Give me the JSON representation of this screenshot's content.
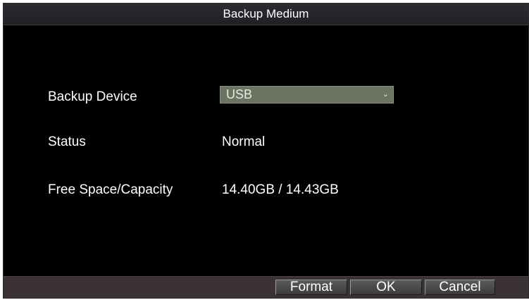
{
  "dialog": {
    "title": "Backup Medium"
  },
  "fields": {
    "backup_device": {
      "label": "Backup Device",
      "value": "USB"
    },
    "status": {
      "label": "Status",
      "value": "Normal"
    },
    "capacity": {
      "label": "Free Space/Capacity",
      "value": "14.40GB / 14.43GB"
    }
  },
  "buttons": {
    "format": "Format",
    "ok": "OK",
    "cancel": "Cancel"
  },
  "icons": {
    "dropdown": "chevron-down-icon"
  },
  "colors": {
    "background": "#000000",
    "titlebar": "#25272c",
    "select_bg": "#6b7362",
    "footer": "#3b3237",
    "text": "#ffffff"
  }
}
